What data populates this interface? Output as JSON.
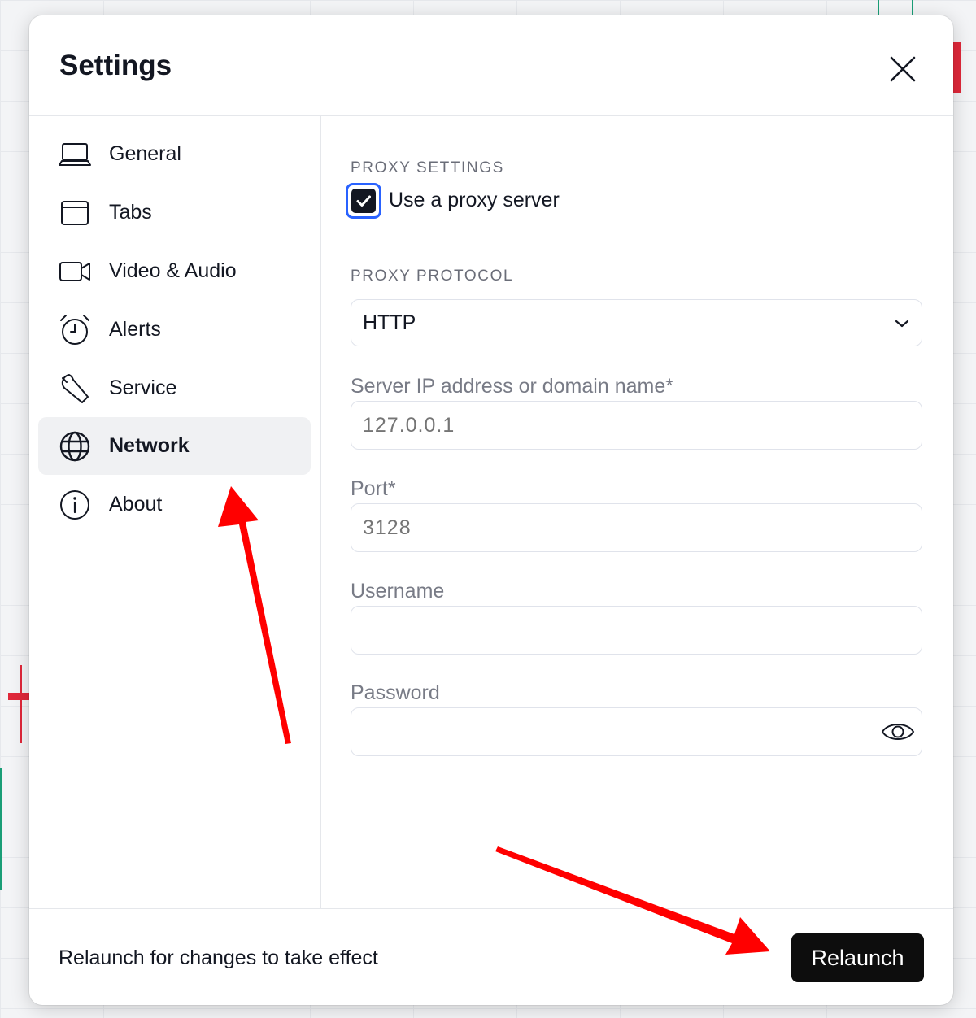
{
  "dialog": {
    "title": "Settings"
  },
  "sidebar": {
    "items": [
      {
        "label": "General",
        "icon": "laptop-icon"
      },
      {
        "label": "Tabs",
        "icon": "tab-window-icon"
      },
      {
        "label": "Video & Audio",
        "icon": "video-camera-icon"
      },
      {
        "label": "Alerts",
        "icon": "alarm-clock-icon"
      },
      {
        "label": "Service",
        "icon": "wrench-icon"
      },
      {
        "label": "Network",
        "icon": "globe-icon",
        "active": true
      },
      {
        "label": "About",
        "icon": "info-icon"
      }
    ]
  },
  "proxy": {
    "section_label": "PROXY SETTINGS",
    "use_proxy_label": "Use a proxy server",
    "use_proxy_checked": true,
    "protocol_label": "PROXY PROTOCOL",
    "protocol_value": "HTTP",
    "server_label": "Server IP address or domain name*",
    "server_placeholder": "127.0.0.1",
    "port_label": "Port*",
    "port_placeholder": "3128",
    "username_label": "Username",
    "username_value": "",
    "password_label": "Password",
    "password_value": ""
  },
  "footer": {
    "message": "Relaunch for changes to take effect",
    "relaunch_label": "Relaunch"
  },
  "colors": {
    "accent": "#2962ff",
    "text": "#131722",
    "muted": "#787b86",
    "annotation_arrow": "#ff0000"
  }
}
